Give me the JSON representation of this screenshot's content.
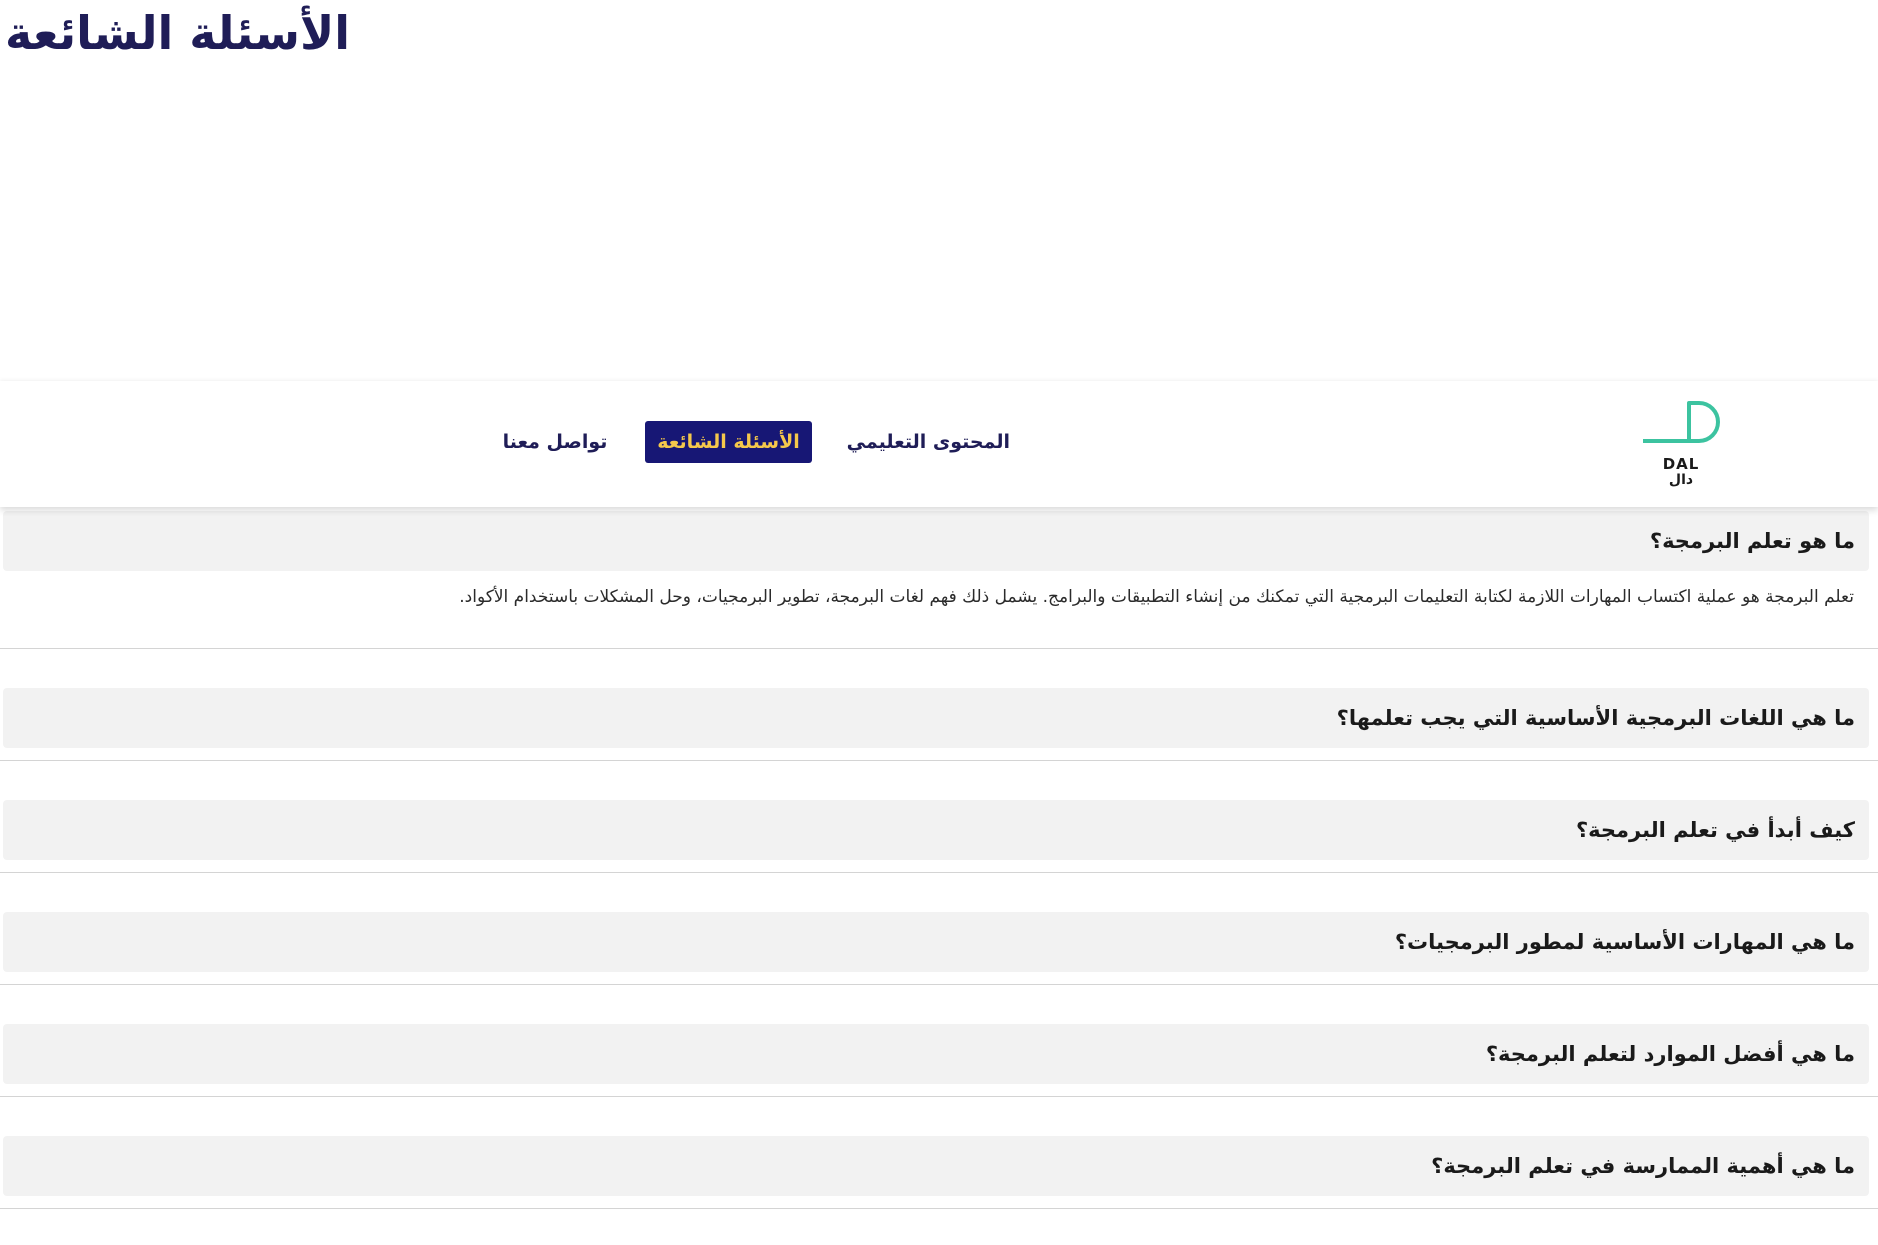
{
  "page": {
    "title": "الأسئلة الشائعة"
  },
  "navbar": {
    "logo": {
      "name_en": "DAL",
      "name_ar": "دال",
      "accent_color": "#3cc3a0"
    },
    "links": {
      "content": "المحتوى التعليمي",
      "faq": "الأسئلة الشائعة",
      "contact": "تواصل معنا"
    },
    "active_link": "faq",
    "active_bg_color": "#171775",
    "active_text_color": "#f5c84b"
  },
  "faq": {
    "items": [
      {
        "question": "ما هو تعلم البرمجة؟",
        "answer": "تعلم البرمجة هو عملية اكتساب المهارات اللازمة لكتابة التعليمات البرمجية التي تمكنك من إنشاء التطبيقات والبرامج. يشمل ذلك فهم لغات البرمجة، تطوير البرمجيات، وحل المشكلات باستخدام الأكواد.",
        "expanded": true
      },
      {
        "question": "ما هي اللغات البرمجية الأساسية التي يجب تعلمها؟",
        "expanded": false
      },
      {
        "question": "كيف أبدأ في تعلم البرمجة؟",
        "expanded": false
      },
      {
        "question": "ما هي المهارات الأساسية لمطور البرمجيات؟",
        "expanded": false
      },
      {
        "question": "ما هي أفضل الموارد لتعلم البرمجة؟",
        "expanded": false
      },
      {
        "question": "ما هي أهمية الممارسة في تعلم البرمجة؟",
        "expanded": false
      }
    ]
  }
}
